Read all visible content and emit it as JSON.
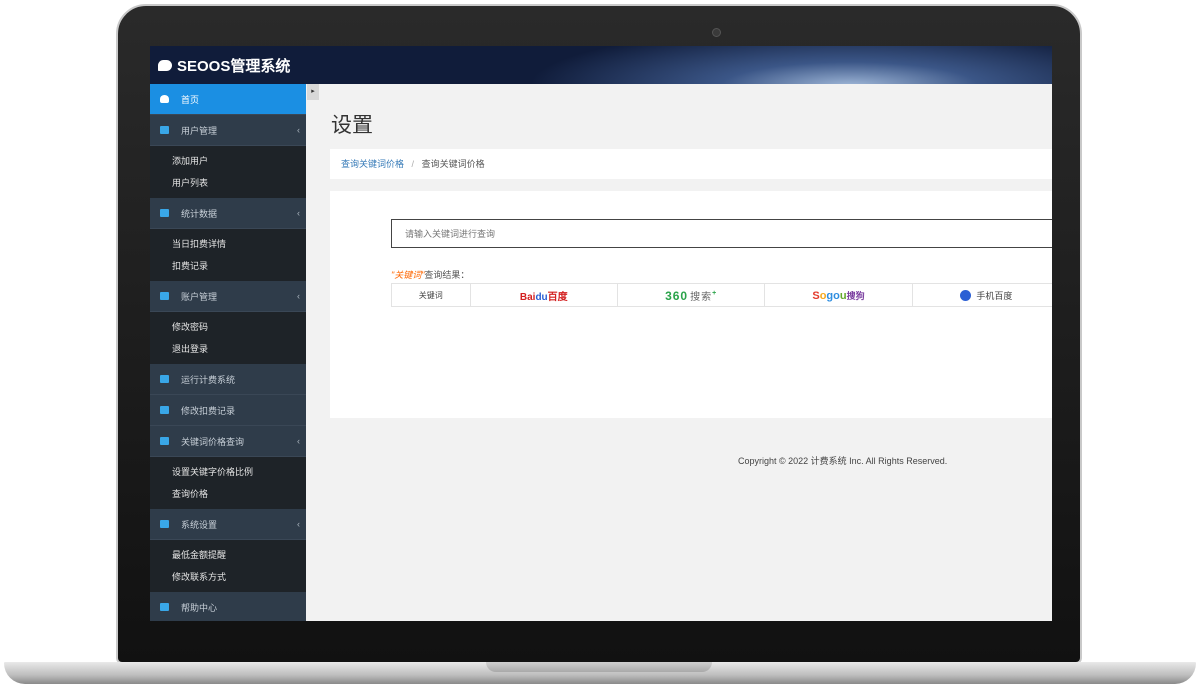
{
  "brand": {
    "title": "SEOOS管理系统"
  },
  "sidebar": {
    "items": [
      {
        "label": "首页",
        "icon": "dashboard-icon",
        "active": true,
        "children": []
      },
      {
        "label": "用户管理",
        "icon": "monitor-icon",
        "children": [
          "添加用户",
          "用户列表"
        ]
      },
      {
        "label": "统计数据",
        "icon": "chart-icon",
        "children": [
          "当日扣费详情",
          "扣费记录"
        ]
      },
      {
        "label": "账户管理",
        "icon": "edit-icon",
        "children": [
          "修改密码",
          "退出登录"
        ]
      },
      {
        "label": "运行计费系统",
        "icon": "file-icon",
        "children": []
      },
      {
        "label": "修改扣费记录",
        "icon": "file-icon",
        "children": []
      },
      {
        "label": "关键词价格查询",
        "icon": "edit-icon",
        "children": [
          "设置关键字价格比例",
          "查询价格"
        ]
      },
      {
        "label": "系统设置",
        "icon": "edit-icon",
        "children": [
          "最低金额提醒",
          "修改联系方式"
        ]
      },
      {
        "label": "帮助中心",
        "icon": "file-icon",
        "children": []
      }
    ],
    "chevron": "‹",
    "collapse_arrow": "▸"
  },
  "page": {
    "title": "设置"
  },
  "breadcrumb": {
    "link": "查询关键词价格",
    "separator": "/",
    "current": "查询关键词价格"
  },
  "search": {
    "placeholder": "请输入关键词进行查询"
  },
  "results": {
    "keyword_tag": "\"关键词\"",
    "caption_suffix": "查询结果：",
    "keyword_header": "关键词",
    "baidu": {
      "a": "Bai",
      "b": "du",
      "c": "百度"
    },
    "s360": {
      "a": "360",
      "b": "搜索",
      "c": "+"
    },
    "sogou": {
      "a": "S",
      "b": "o",
      "c": "go",
      "d": "u",
      "e": "搜狗"
    },
    "mobile_baidu": "手机百度"
  },
  "footer": {
    "copyright": "Copyright © 2022 计费系统 Inc. All Rights Reserved."
  }
}
